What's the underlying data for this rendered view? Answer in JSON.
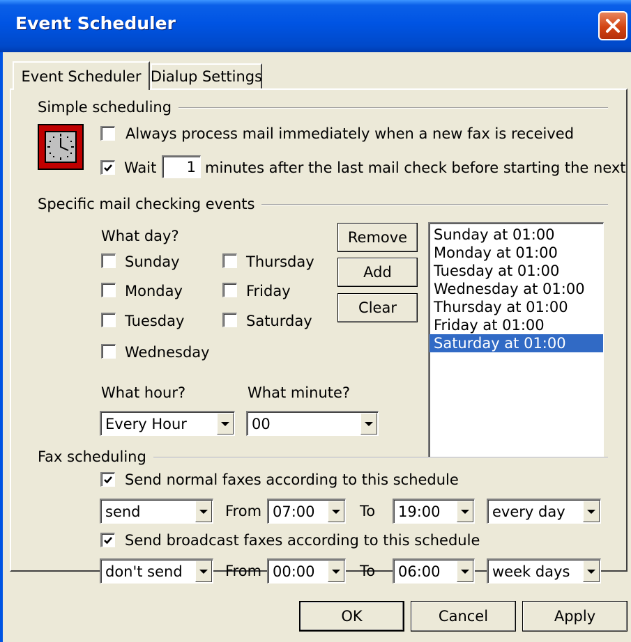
{
  "window": {
    "title": "Event Scheduler"
  },
  "tabs": [
    {
      "label": "Event Scheduler",
      "active": true
    },
    {
      "label": "Dialup Settings",
      "active": false
    }
  ],
  "simple": {
    "group_label": "Simple scheduling",
    "icon": "clock-icon",
    "always_process": {
      "label": "Always process mail immediately when a new fax is received",
      "checked": false
    },
    "wait": {
      "label_pre": "Wait",
      "value": "1",
      "label_post": "minutes after the last mail check before starting the next one",
      "checked": true
    }
  },
  "specific": {
    "group_label": "Specific mail checking events",
    "day_label": "What day?",
    "days": [
      {
        "label": "Sunday",
        "checked": false
      },
      {
        "label": "Monday",
        "checked": false
      },
      {
        "label": "Tuesday",
        "checked": false
      },
      {
        "label": "Wednesday",
        "checked": false
      },
      {
        "label": "Thursday",
        "checked": false
      },
      {
        "label": "Friday",
        "checked": false
      },
      {
        "label": "Saturday",
        "checked": false
      }
    ],
    "buttons": {
      "remove": "Remove",
      "add": "Add",
      "clear": "Clear"
    },
    "hour_label": "What hour?",
    "hour_value": "Every Hour",
    "minute_label": "What minute?",
    "minute_value": "00",
    "events": [
      "Sunday at 01:00",
      "Monday at 01:00",
      "Tuesday at 01:00",
      "Wednesday at 01:00",
      "Thursday at 01:00",
      "Friday at 01:00",
      "Saturday at 01:00"
    ],
    "selected_event": "Saturday at 01:00"
  },
  "fax": {
    "group_label": "Fax scheduling",
    "normal": {
      "label": "Send normal faxes according to this schedule",
      "checked": true,
      "action": "send",
      "from_label": "From",
      "from": "07:00",
      "to_label": "To",
      "to": "19:00",
      "days": "every day"
    },
    "broadcast": {
      "label": "Send broadcast faxes according to this schedule",
      "checked": true,
      "action": "don't send",
      "from_label": "From",
      "from": "00:00",
      "to_label": "To",
      "to": "06:00",
      "days": "week days"
    }
  },
  "footer": {
    "ok": "OK",
    "cancel": "Cancel",
    "apply": "Apply"
  },
  "colors": {
    "titlebar": "#0054e3",
    "selection": "#316ac5",
    "face": "#ece9d8",
    "close": "#d24412"
  }
}
